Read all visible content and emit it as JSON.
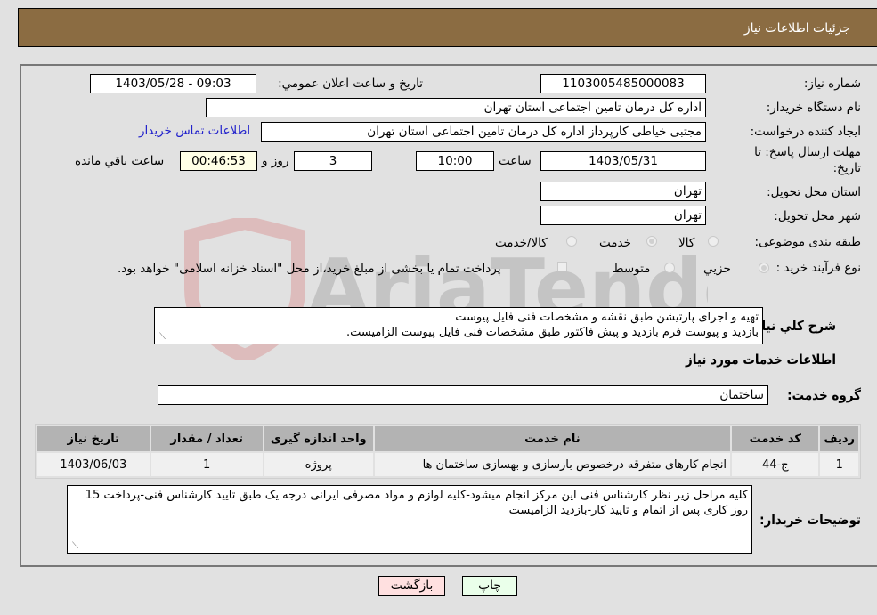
{
  "header": {
    "title": "جزئیات اطلاعات نیاز"
  },
  "form": {
    "need_number": {
      "label": "شماره نیاز:",
      "value": "1103005485000083"
    },
    "announce_datetime": {
      "label": "تاریخ و ساعت اعلان عمومي:",
      "value": "1403/05/28 - 09:03"
    },
    "buyer_org": {
      "label": "نام دستگاه خریدار:",
      "value": "اداره کل درمان تامین اجتماعی استان تهران"
    },
    "requester": {
      "label": "ایجاد کننده درخواست:",
      "value": "مجتبی خیاطی کارپرداز اداره کل درمان تامین اجتماعی استان تهران"
    },
    "buyer_contact_link": "اطلاعات تماس خریدار",
    "deadline": {
      "label_line1": "مهلت ارسال پاسخ: تا",
      "label_line2": "تاریخ:",
      "date": "1403/05/31",
      "time_label": "ساعت",
      "time": "10:00",
      "days": "3",
      "days_label": "روز و",
      "remaining": "00:46:53",
      "remaining_label": "ساعت باقي مانده"
    },
    "delivery_province": {
      "label": "استان محل تحویل:",
      "value": "تهران"
    },
    "delivery_city": {
      "label": "شهر محل تحویل:",
      "value": "تهران"
    },
    "category": {
      "label": "طبقه بندی موضوعی:",
      "options": [
        "کالا",
        "خدمت",
        "کالا/خدمت"
      ],
      "selected": "خدمت"
    },
    "purchase_type": {
      "label": "نوع فرآیند خرید :",
      "options": [
        "جزيي",
        "متوسط"
      ],
      "selected": "جزيي",
      "treasury_note": "پرداخت تمام یا بخشی از مبلغ خرید،از محل \"اسناد خزانه اسلامی\" خواهد بود."
    },
    "general_description": {
      "label": "شرح کلي نياز:",
      "line1": "تهیه و اجرای پارتیشن طبق نقشه و مشخصات فنی فایل پیوست",
      "line2": "بازدید و پیوست فرم بازدید و پیش فاکتور طبق مشخصات فنی فایل پیوست الزامیست."
    }
  },
  "services": {
    "section_title": "اطلاعات خدمات مورد نياز",
    "group_label": "گروه خدمت:",
    "group_value": "ساختمان",
    "table": {
      "headers": [
        "رديف",
        "کد خدمت",
        "نام خدمت",
        "واحد اندازه گیری",
        "تعداد / مقدار",
        "تاریخ نیاز"
      ],
      "rows": [
        [
          "1",
          "ج-44",
          "انجام کارهای متفرقه درخصوص بازسازی و بهسازی ساختمان ها",
          "پروژه",
          "1",
          "1403/06/03"
        ]
      ]
    }
  },
  "buyer_notes": {
    "label": "توضیحات خریدار:",
    "text": "کلیه مراحل زیر نظر کارشناس فنی این مرکز انجام میشود-کلیه لوازم و مواد مصرفی ایرانی درجه یک طبق تایید کارشناس فنی-پرداخت 15 روز کاری پس از اتمام و تایید کار-بازدید الزامیست"
  },
  "buttons": {
    "print": "چاپ",
    "back": "بازگشت"
  },
  "watermark": "AriaTender.neT",
  "colors": {
    "header": "#8b6c42",
    "print_bg": "#eaffea",
    "back_bg": "#ffe0e0",
    "link": "#2222cc"
  }
}
